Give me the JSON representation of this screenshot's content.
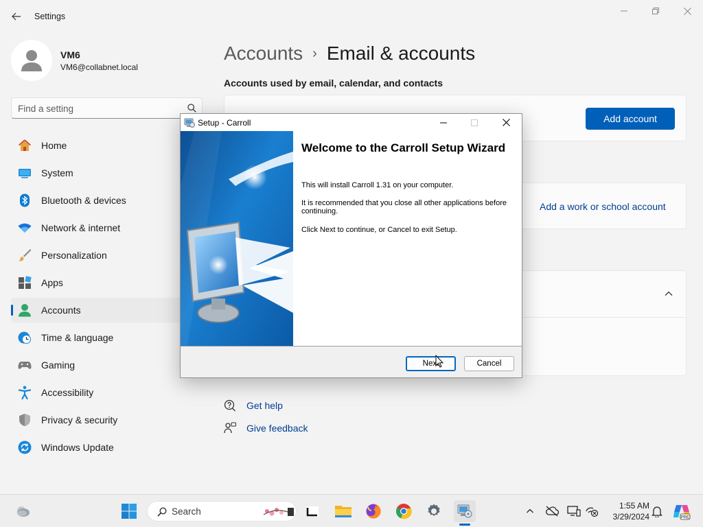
{
  "window": {
    "title": "Settings",
    "minimize_icon": "minimize-icon",
    "maximize_icon": "restore-icon",
    "close_icon": "close-icon"
  },
  "profile": {
    "name": "VM6",
    "email": "VM6@collabnet.local"
  },
  "search": {
    "placeholder": "Find a setting"
  },
  "nav": {
    "items": [
      {
        "label": "Home",
        "icon": "home-icon"
      },
      {
        "label": "System",
        "icon": "system-icon"
      },
      {
        "label": "Bluetooth & devices",
        "icon": "bluetooth-icon"
      },
      {
        "label": "Network & internet",
        "icon": "wifi-icon"
      },
      {
        "label": "Personalization",
        "icon": "brush-icon"
      },
      {
        "label": "Apps",
        "icon": "apps-icon"
      },
      {
        "label": "Accounts",
        "icon": "accounts-icon",
        "active": true
      },
      {
        "label": "Time & language",
        "icon": "clock-globe-icon"
      },
      {
        "label": "Gaming",
        "icon": "gamepad-icon"
      },
      {
        "label": "Accessibility",
        "icon": "accessibility-icon"
      },
      {
        "label": "Privacy & security",
        "icon": "shield-icon"
      },
      {
        "label": "Windows Update",
        "icon": "update-icon"
      }
    ]
  },
  "page": {
    "breadcrumb_parent": "Accounts",
    "breadcrumb_separator": "›",
    "breadcrumb_current": "Email & accounts",
    "section_title": "Accounts used by email, calendar, and contacts",
    "add_account_label": "Add account",
    "work_school_label": "Add a work or school account",
    "get_help_label": "Get help",
    "give_feedback_label": "Give feedback"
  },
  "dialog": {
    "title": "Setup - Carroll",
    "heading": "Welcome to the Carroll Setup Wizard",
    "p1": "This will install Carroll 1.31 on your computer.",
    "p2": "It is recommended that you close all other applications before continuing.",
    "p3": "Click Next to continue, or Cancel to exit Setup.",
    "next_label": "Next",
    "cancel_label": "Cancel"
  },
  "taskbar": {
    "search_label": "Search",
    "time": "1:55 AM",
    "date": "3/29/2024",
    "apps": [
      "windows-start-icon",
      "file-explorer-icon",
      "firefox-icon",
      "chrome-icon",
      "settings-gear-icon",
      "setup-installer-icon"
    ],
    "tray": [
      "chevron-up-icon",
      "onedrive-offline-icon",
      "display-icon",
      "network-offline-icon",
      "notification-bell-icon",
      "copilot-pre-icon"
    ]
  },
  "colors": {
    "accent": "#005fb8",
    "link": "#003e92",
    "background": "#f3f3f3"
  }
}
